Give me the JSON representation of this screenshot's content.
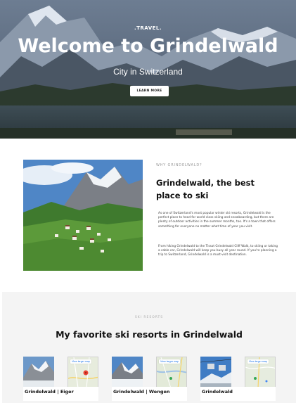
{
  "hero": {
    "brand": ".TRAVEL.",
    "title": "Welcome to Grindelwald",
    "subtitle": "City in Switzerland",
    "button_label": "LEARN MORE"
  },
  "about": {
    "eyebrow": "WHY GRINDELWALD?",
    "heading": "Grindelwald, the best place to ski",
    "paragraph_1": "As one of Switzerland's most popular winter ski resorts, Grindelwald is the perfect place to head for world class skiing and snowboarding, but there are plenty of outdoor activities in the summer months, too. It's a town that offers something for everyone no matter what time of year you visit.",
    "paragraph_2": "From hiking Grindelwald to the Tissot Grindelwald Cliff Walk, to skiing or taking a cable car, Grindelwald will keep you busy all year round. If you're planning a trip to Switzerland, Grindelwald is a must-visit destination."
  },
  "resorts": {
    "eyebrow": "SKI RESORTS",
    "title": "My favorite ski resorts in Grindelwald",
    "cards": [
      {
        "name": "Grindelwald | Eiger",
        "map_link": "View larger map"
      },
      {
        "name": "Grindelwald | Wengen",
        "map_link": "View larger map"
      },
      {
        "name": "Grindelwald",
        "map_link": "View larger map"
      }
    ]
  }
}
